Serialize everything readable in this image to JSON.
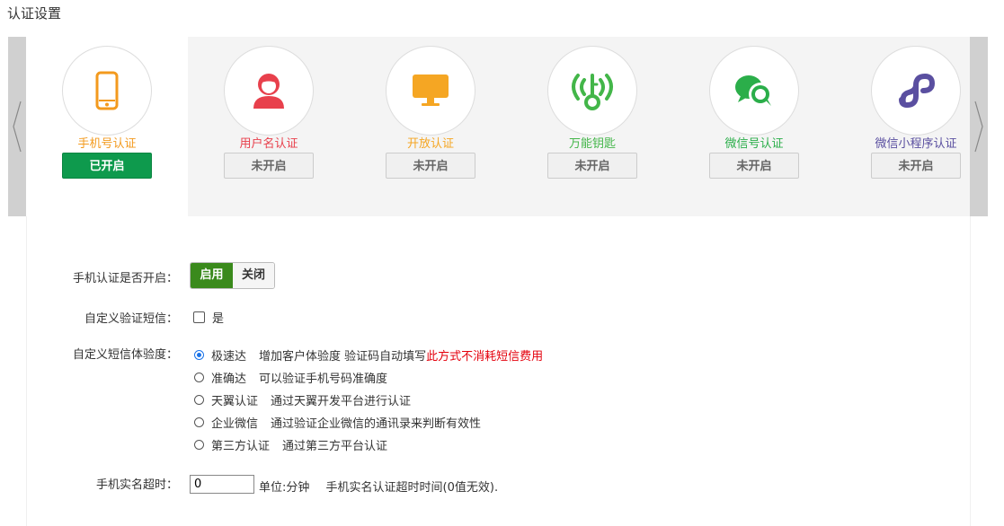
{
  "page_title": "认证设置",
  "auth_methods": [
    {
      "label": "手机号认证",
      "status": "已开启",
      "color": "#f39a1e",
      "icon": "phone-icon",
      "active": true
    },
    {
      "label": "用户名认证",
      "status": "未开启",
      "color": "#e8404c",
      "icon": "user-icon",
      "active": false
    },
    {
      "label": "开放认证",
      "status": "未开启",
      "color": "#f5a623",
      "icon": "monitor-icon",
      "active": false
    },
    {
      "label": "万能钥匙",
      "status": "未开启",
      "color": "#43b649",
      "icon": "wifi-key-icon",
      "active": false
    },
    {
      "label": "微信号认证",
      "status": "未开启",
      "color": "#2bae4a",
      "icon": "wechat-icon",
      "active": false
    },
    {
      "label": "微信小程序认证",
      "status": "未开启",
      "color": "#5a4fa0",
      "icon": "mini-program-icon",
      "active": false
    }
  ],
  "form": {
    "enable_label": "手机认证是否开启：",
    "enable_on": "启用",
    "enable_off": "关闭",
    "custom_sms_label": "自定义验证短信：",
    "custom_sms_option": "是",
    "sms_exp_label": "自定义短信体验度：",
    "sms_options": [
      {
        "name": "极速达",
        "desc": "增加客户体验度 验证码自动填写",
        "note": "此方式不消耗短信费用",
        "selected": true
      },
      {
        "name": "准确达",
        "desc": "可以验证手机号码准确度",
        "note": "",
        "selected": false
      },
      {
        "name": "天翼认证",
        "desc": "通过天翼开发平台进行认证",
        "note": "",
        "selected": false
      },
      {
        "name": "企业微信",
        "desc": "通过验证企业微信的通讯录来判断有效性",
        "note": "",
        "selected": false
      },
      {
        "name": "第三方认证",
        "desc": "通过第三方平台认证",
        "note": "",
        "selected": false
      }
    ],
    "timeout_label": "手机实名超时：",
    "timeout_value": "0",
    "timeout_unit": "单位:分钟",
    "timeout_desc": "手机实名认证超时时间(0值无效)."
  }
}
